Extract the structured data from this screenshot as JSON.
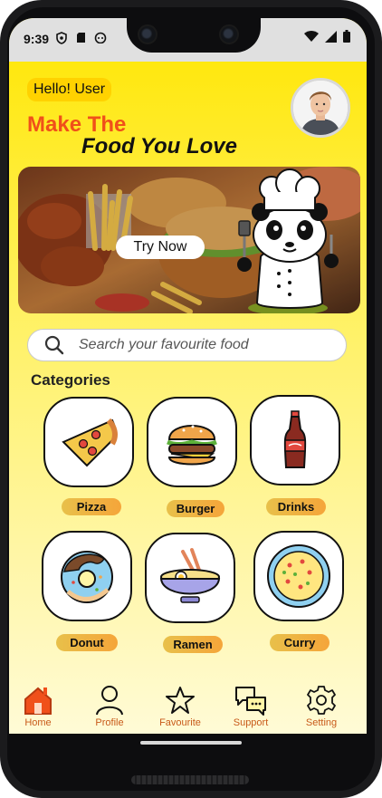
{
  "status_bar": {
    "time": "9:39",
    "icons": [
      "shield-icon",
      "sd-card-icon",
      "android-icon",
      "wifi-icon",
      "signal-icon",
      "battery-icon"
    ]
  },
  "header": {
    "greeting": "Hello! User",
    "headline_line1": "Make The",
    "headline_line2": "Food You Love",
    "avatar": "user-avatar"
  },
  "banner": {
    "cta_label": "Try Now",
    "mascot": "panda-chef-illustration"
  },
  "search": {
    "placeholder": "Search your favourite food"
  },
  "categories": {
    "title": "Categories",
    "items": [
      {
        "label": "Pizza",
        "icon": "pizza-icon"
      },
      {
        "label": "Burger",
        "icon": "burger-icon"
      },
      {
        "label": "Drinks",
        "icon": "drinks-icon"
      },
      {
        "label": "Donut",
        "icon": "donut-icon"
      },
      {
        "label": "Ramen",
        "icon": "ramen-icon"
      },
      {
        "label": "Curry",
        "icon": "curry-icon"
      }
    ]
  },
  "bottom_nav": {
    "items": [
      {
        "label": "Home",
        "icon": "home-icon",
        "active": true
      },
      {
        "label": "Profile",
        "icon": "profile-icon"
      },
      {
        "label": "Favourite",
        "icon": "star-icon"
      },
      {
        "label": "Support",
        "icon": "chat-bubbles-icon"
      },
      {
        "label": "Setting",
        "icon": "gear-icon"
      }
    ]
  },
  "colors": {
    "accent_orange": "#f0501a",
    "background_top": "#ffe600",
    "background_bottom": "#fffbd6",
    "nav_label": "#c85a1a",
    "pill": "#f5a53a"
  }
}
